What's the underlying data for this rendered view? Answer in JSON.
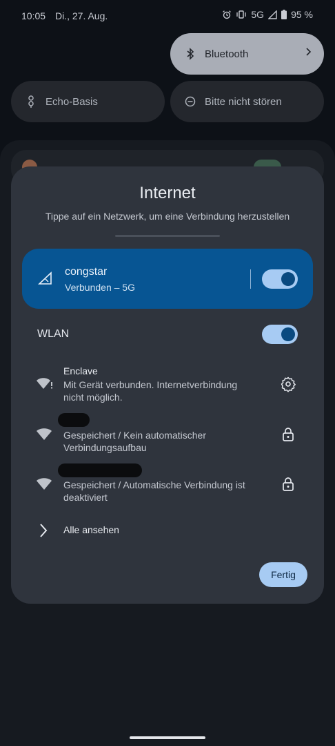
{
  "status_bar": {
    "time": "10:05",
    "date": "Di., 27. Aug.",
    "network": "5G",
    "battery": "95 %"
  },
  "quick_tiles": {
    "bluetooth": "Bluetooth",
    "echo": "Echo-Basis",
    "dnd": "Bitte nicht stören"
  },
  "dialog": {
    "title": "Internet",
    "subtitle": "Tippe auf ein Netzwerk, um eine Verbindung herzustellen",
    "mobile": {
      "name": "congstar",
      "status": "Verbunden – 5G",
      "enabled": true
    },
    "wlan": {
      "label": "WLAN",
      "enabled": true
    },
    "networks": [
      {
        "name": "Enclave",
        "status_line1": "Mit Gerät verbunden. Internetverbindung",
        "status_line2": "nicht möglich.",
        "action_icon": "gear-icon"
      },
      {
        "name": "",
        "status_line1": "Gespeichert / Kein automatischer",
        "status_line2": "Verbindungsaufbau",
        "action_icon": "lock-icon"
      },
      {
        "name": "",
        "status_line1": "Gespeichert / Automatische Verbindung ist",
        "status_line2": "deaktiviert",
        "action_icon": "lock-icon"
      }
    ],
    "see_all": "Alle ansehen",
    "done": "Fertig"
  },
  "colors": {
    "accent": "#a7cbf3",
    "mobile_card": "#075593",
    "dialog_bg": "#2f343d"
  }
}
